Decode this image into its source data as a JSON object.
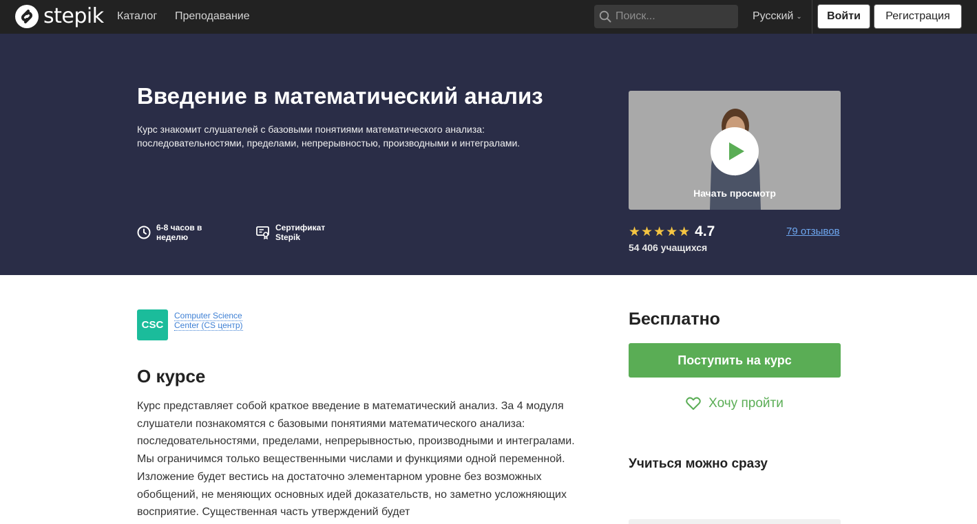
{
  "navbar": {
    "logo_text": "stepik",
    "links": [
      "Каталог",
      "Преподавание"
    ],
    "search_placeholder": "Поиск...",
    "language": "Русский",
    "login_label": "Войти",
    "register_label": "Регистрация"
  },
  "hero": {
    "title": "Введение в математический анализ",
    "subtitle": "Курс знакомит слушателей с базовыми понятиями математического анализа: последовательностями, пределами, непрерывностью, производными и интегралами.",
    "hours": "6-8 часов в неделю",
    "certificate": "Сертификат Stepik",
    "video_label": "Начать просмотр",
    "stars": "★★★★★",
    "rating": "4.7",
    "reviews": "79 отзывов",
    "learners": "54 406 учащихся"
  },
  "organization": {
    "logo_text": "CSC",
    "name": "Computer Science Center (CS центр)"
  },
  "about": {
    "title": "О курсе",
    "text": "Курс представляет собой краткое введение в математический анализ. За 4 модуля слушатели познакомятся с базовыми понятиями математического анализа: последовательностями, пределами, непрерывностью, производными и интегралами. Мы ограничимся только вещественными числами и функциями одной переменной. Изложение будет вестись на достаточно элементарном уровне без возможных обобщений, не меняющих основных идей доказательств, но заметно усложняющих восприятие. Существенная часть утверждений будет"
  },
  "sidebar": {
    "price": "Бесплатно",
    "enroll_label": "Поступить на курс",
    "wishlist_label": "Хочу пройти",
    "learn_now": "Учиться можно сразу"
  },
  "colors": {
    "navbar_bg": "#222222",
    "hero_bg": "#2a2d47",
    "accent_green": "#5aad55",
    "link_blue": "#6ea7f0",
    "star_yellow": "#f5c542",
    "org_teal": "#1bbc9b"
  },
  "icons": [
    "stepik-logo-icon",
    "search-icon",
    "chevron-down-icon",
    "clock-icon",
    "certificate-icon",
    "play-icon",
    "heart-icon"
  ]
}
